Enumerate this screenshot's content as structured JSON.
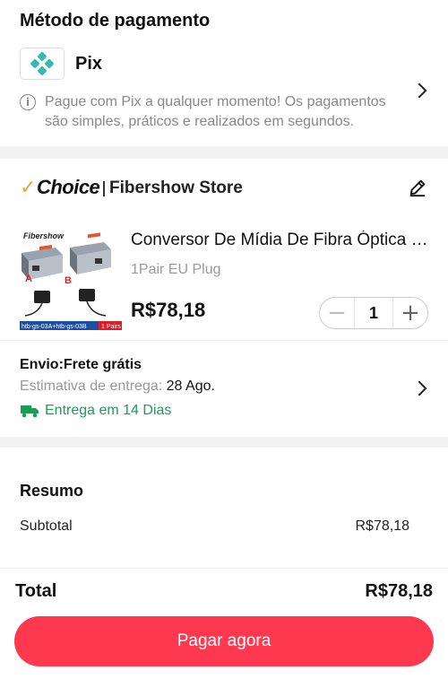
{
  "payment": {
    "title": "Método de pagamento",
    "method_label": "Pix",
    "method_icon": "pix-icon",
    "info_text": "Pague com Pix a qualquer momento! Os pagamentos são simples, práticos e realizados em segundos.",
    "pix_color": "#32bcad"
  },
  "store": {
    "badge": "Choice",
    "name": "Fibershow Store",
    "badge_accent": "#f5a623"
  },
  "product": {
    "image_brand": "Fibershow",
    "image_labels": [
      "A",
      "B"
    ],
    "image_caption": "htb-gs-03A+htb-gs-03B",
    "image_pairs": "1 Pairs",
    "title": "Conversor De Mídia De Fibra Óptica Gigabit",
    "variant": "1Pair EU Plug",
    "price": "R$78,18",
    "quantity": "1"
  },
  "shipping": {
    "title": "Envio:Frete grátis",
    "estimate_label": "Estimativa de entrega:",
    "estimate_date": "28 Ago.",
    "fast_label": "Entrega em 14 Dias",
    "fast_color": "#1a9e55"
  },
  "summary": {
    "title": "Resumo",
    "subtotal_label": "Subtotal",
    "subtotal_value": "R$78,18"
  },
  "footer": {
    "total_label": "Total",
    "total_value": "R$78,18",
    "pay_button": "Pagar agora",
    "button_color": "#fd384f"
  }
}
